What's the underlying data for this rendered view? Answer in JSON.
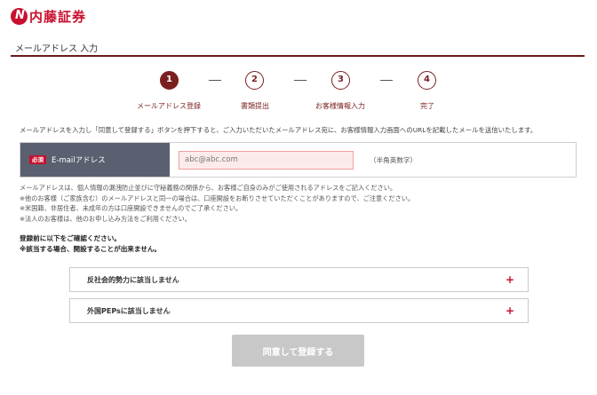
{
  "header": {
    "logo_icon": "nomura-logo-mark",
    "logo_mark_char": "N",
    "brand_name": "内藤証券",
    "brand_color": "#c8102e"
  },
  "page": {
    "title": "メールアドレス 入力"
  },
  "steps": [
    {
      "number": "1",
      "label": "メールアドレス登録",
      "active": true
    },
    {
      "number": "2",
      "label": "書類提出",
      "active": false
    },
    {
      "number": "3",
      "label": "お客様情報入力",
      "active": false
    },
    {
      "number": "4",
      "label": "完了",
      "active": false
    }
  ],
  "step_separator": "—",
  "instruction": "メールアドレスを入力し「同意して登録する」ボタンを押下すると、ご入力いただいたメールアドレス宛に、お客様情報入力画面へのURLを記載したメールを送信いたします。",
  "email_field": {
    "required_badge": "必須",
    "label": "E-mailアドレス",
    "value": "",
    "placeholder": "abc@abc.com",
    "hint": "（半角英数字）"
  },
  "notes": [
    "メールアドレスは、個人情報の漏洩防止並びに守秘義務の関係から、お客様ご自身のみがご使用されるアドレスをご記入ください。",
    "※他のお客様（ご家族含む）のメールアドレスと同一の場合は、口座開設をお断りさせていただくことがありますので、ご注意ください。",
    "※米国籍、非居住者、未成年の方は口座開設できませんのでご了承ください。",
    "※法人のお客様は、他のお申し込み方法をご利用ください。"
  ],
  "confirm": {
    "line1": "登録前に以下をご確認ください。",
    "line2": "※該当する場合、開設することが出来ません。"
  },
  "accordions": [
    {
      "label": "反社会的勢力に該当しません",
      "icon": "plus-icon"
    },
    {
      "label": "外国PEPsに該当しません",
      "icon": "plus-icon"
    }
  ],
  "plus_char": "+",
  "submit": {
    "label": "同意して登録する",
    "disabled": true
  },
  "colors": {
    "accent": "#7a1f1f",
    "label_cell": "#5a6070",
    "input_bg": "#fdebeb",
    "button_disabled": "#c8c8c8"
  }
}
